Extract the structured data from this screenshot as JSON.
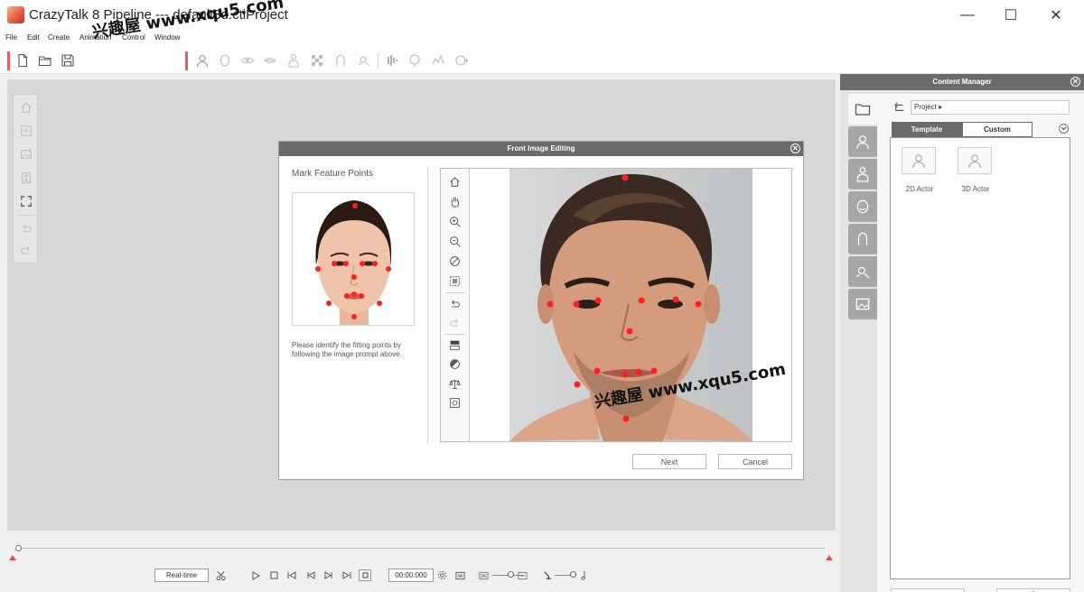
{
  "window": {
    "title": "CrazyTalk 8 Pipeline --- default3d.ctiProject",
    "minimize": "—",
    "maximize": "☐",
    "close": "✕"
  },
  "menu": [
    "File",
    "Edit",
    "Create",
    "Animation",
    "Control",
    "Window"
  ],
  "watermark": {
    "cn": "兴趣屋",
    "url": "www.xqu5.com"
  },
  "dialog": {
    "title": "Front Image Editing",
    "close": "✕",
    "left_title": "Mark Feature Points",
    "instruction": "Please identify the fitting points by following the image prompt above.",
    "next_label": "Next",
    "cancel_label": "Cancel"
  },
  "content_manager": {
    "title": "Content Manager",
    "close": "✕",
    "path": "Project ▸",
    "tabs": [
      "Template",
      "Custom"
    ],
    "items": [
      "2D Actor",
      "3D Actor"
    ],
    "side_tabs": [
      "folder-icon",
      "actor-icon",
      "body-icon",
      "face-icon",
      "head-icon",
      "motion-icon",
      "image-icon"
    ]
  },
  "timeline": {
    "realtime_label": "Real-time",
    "timecode": "00:00:000"
  },
  "colors": {
    "header_gray": "#6b6b6b",
    "feature_point_red": "#ff1f1f",
    "accent_red": "#e35d5d"
  }
}
